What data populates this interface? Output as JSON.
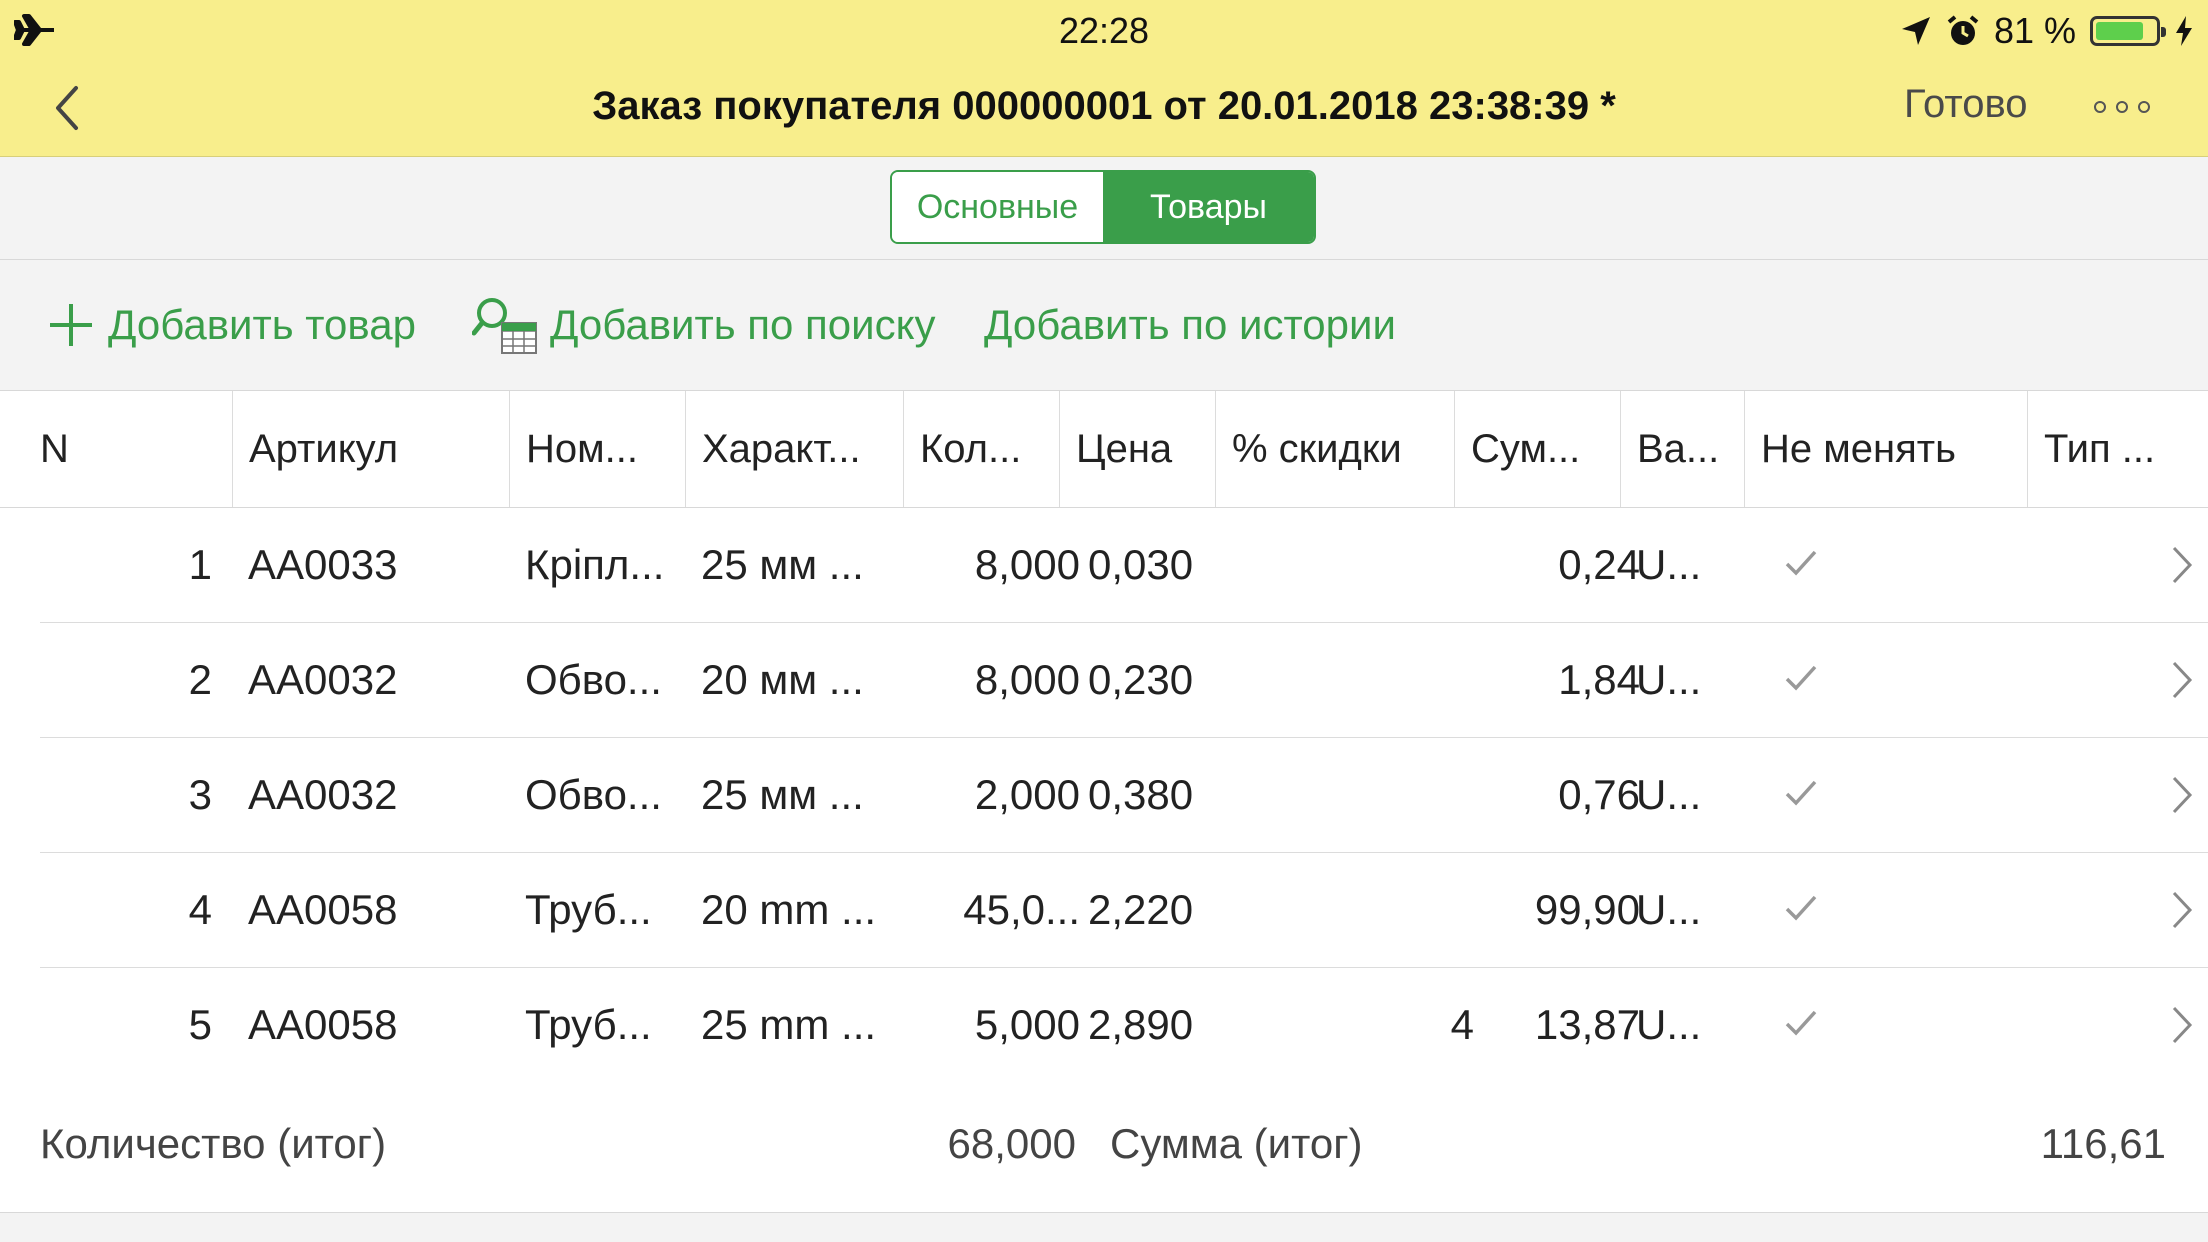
{
  "status_bar": {
    "time": "22:28",
    "battery_text": "81 %",
    "battery_level": 0.81,
    "icons": [
      "airplane-icon",
      "location-icon",
      "alarm-icon",
      "battery-icon",
      "charging-icon"
    ]
  },
  "nav": {
    "title": "Заказ покупателя 000000001 от 20.01.2018 23:38:39 *",
    "done_label": "Готово"
  },
  "tabs": [
    {
      "label": "Основные",
      "selected": false
    },
    {
      "label": "Товары",
      "selected": true
    }
  ],
  "commands": {
    "add_item": "Добавить товар",
    "add_by_search": "Добавить по поиску",
    "add_by_history": "Добавить по истории"
  },
  "columns": [
    "N",
    "Артикул",
    "Ном...",
    "Характ...",
    "Кол...",
    "Цена",
    "% скидки",
    "Сум...",
    "Ва...",
    "Не менять",
    "Тип ..."
  ],
  "rows": [
    {
      "n": "1",
      "sku": "АА0033",
      "name": "Кріпл...",
      "char": "25 мм ...",
      "qty": "8,000",
      "price": "0,030",
      "discount": "",
      "sum": "0,24",
      "currency": "U...",
      "keep": true
    },
    {
      "n": "2",
      "sku": "АА0032",
      "name": "Обво...",
      "char": "20 мм ...",
      "qty": "8,000",
      "price": "0,230",
      "discount": "",
      "sum": "1,84",
      "currency": "U...",
      "keep": true
    },
    {
      "n": "3",
      "sku": "АА0032",
      "name": "Обво...",
      "char": "25 мм ...",
      "qty": "2,000",
      "price": "0,380",
      "discount": "",
      "sum": "0,76",
      "currency": "U...",
      "keep": true
    },
    {
      "n": "4",
      "sku": "АА0058",
      "name": "Труб...",
      "char": "20 mm ...",
      "qty": "45,0...",
      "price": "2,220",
      "discount": "",
      "sum": "99,90",
      "currency": "U...",
      "keep": true
    },
    {
      "n": "5",
      "sku": "АА0058",
      "name": "Труб...",
      "char": "25 mm ...",
      "qty": "5,000",
      "price": "2,890",
      "discount": "4",
      "sum": "13,87",
      "currency": "U...",
      "keep": true
    }
  ],
  "totals": {
    "qty_label": "Количество (итог)",
    "qty_value": "68,000",
    "sum_label": "Сумма (итог)",
    "sum_value": "116,61"
  },
  "colors": {
    "header_bg": "#f8ee8c",
    "accent_green": "#3a9e4a",
    "panel_bg": "#f3f3f3"
  }
}
